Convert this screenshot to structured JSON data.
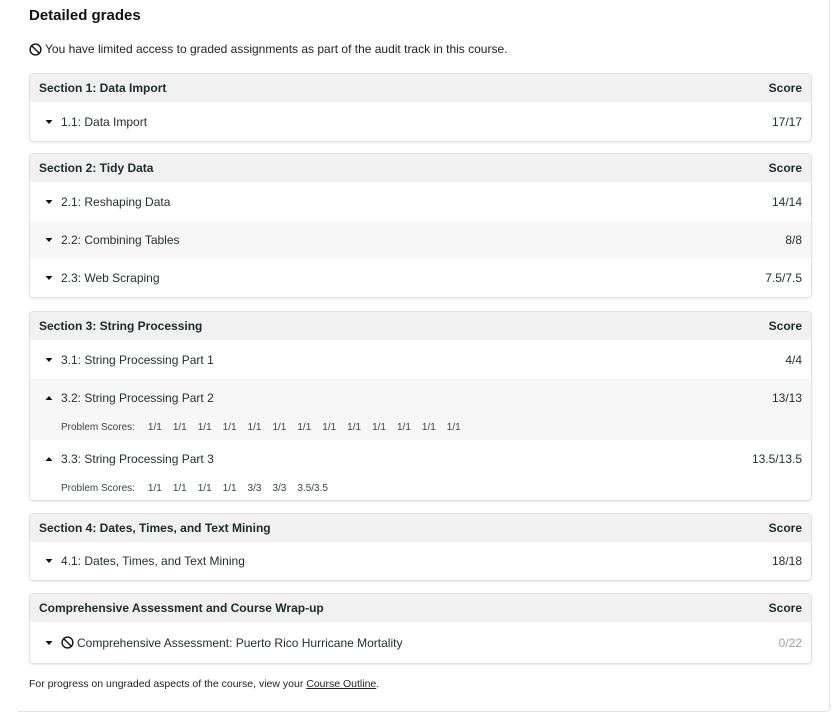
{
  "title": "Detailed grades",
  "notice": "You have limited access to graded assignments as part of the audit track in this course.",
  "score_header": "Score",
  "sections": [
    {
      "title": "Section 1: Data Import",
      "items": [
        {
          "label": "1.1: Data Import",
          "score": "17/17"
        }
      ]
    },
    {
      "title": "Section 2: Tidy Data",
      "items": [
        {
          "label": "2.1: Reshaping Data",
          "score": "14/14"
        },
        {
          "label": "2.2: Combining Tables",
          "score": "8/8"
        },
        {
          "label": "2.3: Web Scraping",
          "score": "7.5/7.5"
        }
      ]
    },
    {
      "title": "Section 3: String Processing",
      "items": [
        {
          "label": "3.1: String Processing Part 1",
          "score": "4/4"
        },
        {
          "label": "3.2: String Processing Part 2",
          "score": "13/13",
          "problem_label": "Problem Scores:",
          "problem_scores": [
            "1/1",
            "1/1",
            "1/1",
            "1/1",
            "1/1",
            "1/1",
            "1/1",
            "1/1",
            "1/1",
            "1/1",
            "1/1",
            "1/1",
            "1/1"
          ]
        },
        {
          "label": "3.3: String Processing Part 3",
          "score": "13.5/13.5",
          "problem_label": "Problem Scores:",
          "problem_scores": [
            "1/1",
            "1/1",
            "1/1",
            "1/1",
            "3/3",
            "3/3",
            "3.5/3.5"
          ]
        }
      ]
    },
    {
      "title": "Section 4: Dates, Times, and Text Mining",
      "items": [
        {
          "label": "4.1: Dates, Times, and Text Mining",
          "score": "18/18"
        }
      ]
    },
    {
      "title": "Comprehensive Assessment and Course Wrap-up",
      "items": [
        {
          "label": "Comprehensive Assessment: Puerto Rico Hurricane Mortality",
          "score": "0/22"
        }
      ]
    }
  ],
  "footer": {
    "text": "For progress on ungraded aspects of the course, view your",
    "link": "Course Outline",
    "end": "."
  },
  "icons": {
    "ban": "ban-icon",
    "caret_down": "caret-down-icon",
    "caret_up": "caret-up-icon"
  },
  "colors": {
    "header_bg": "#f1f1f1",
    "alt_row_bg": "#f7f7f7",
    "muted_score": "#9aa3a4"
  }
}
